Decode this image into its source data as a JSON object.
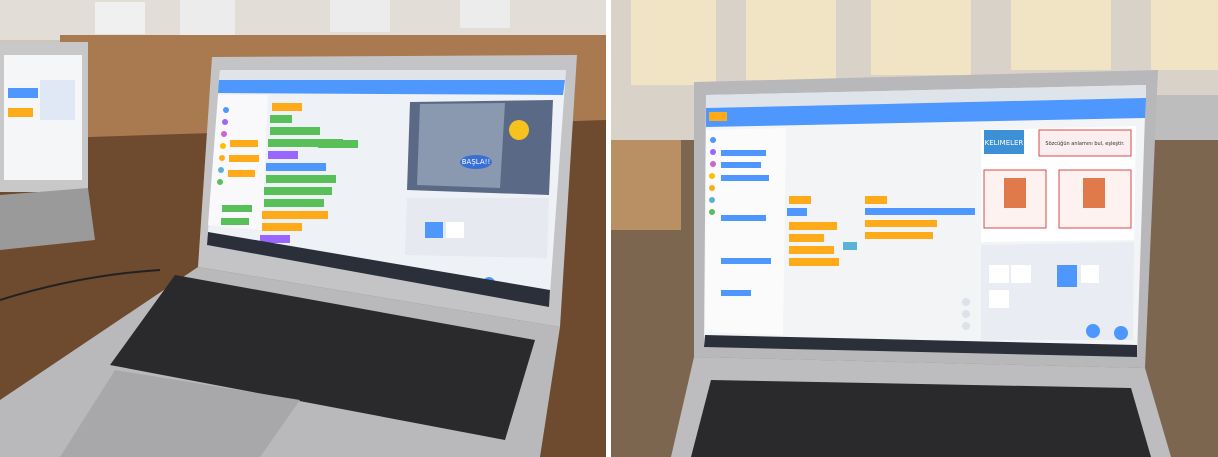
{
  "photos": [
    {
      "id": "left",
      "stage_bubble_text": "BAŞLA!!",
      "colors": {
        "scratch_blue": "#4d97ff",
        "block_orange": "#ffab19",
        "block_green": "#59c059",
        "block_purple": "#9966ff"
      }
    },
    {
      "id": "right",
      "stage_logo_text": "KELIMELER",
      "stage_card_text": "Sözcüğün anlamını bul, eşleştir.",
      "colors": {
        "scratch_blue": "#4d97ff",
        "block_orange": "#ffab19",
        "block_green": "#59c059"
      }
    }
  ]
}
